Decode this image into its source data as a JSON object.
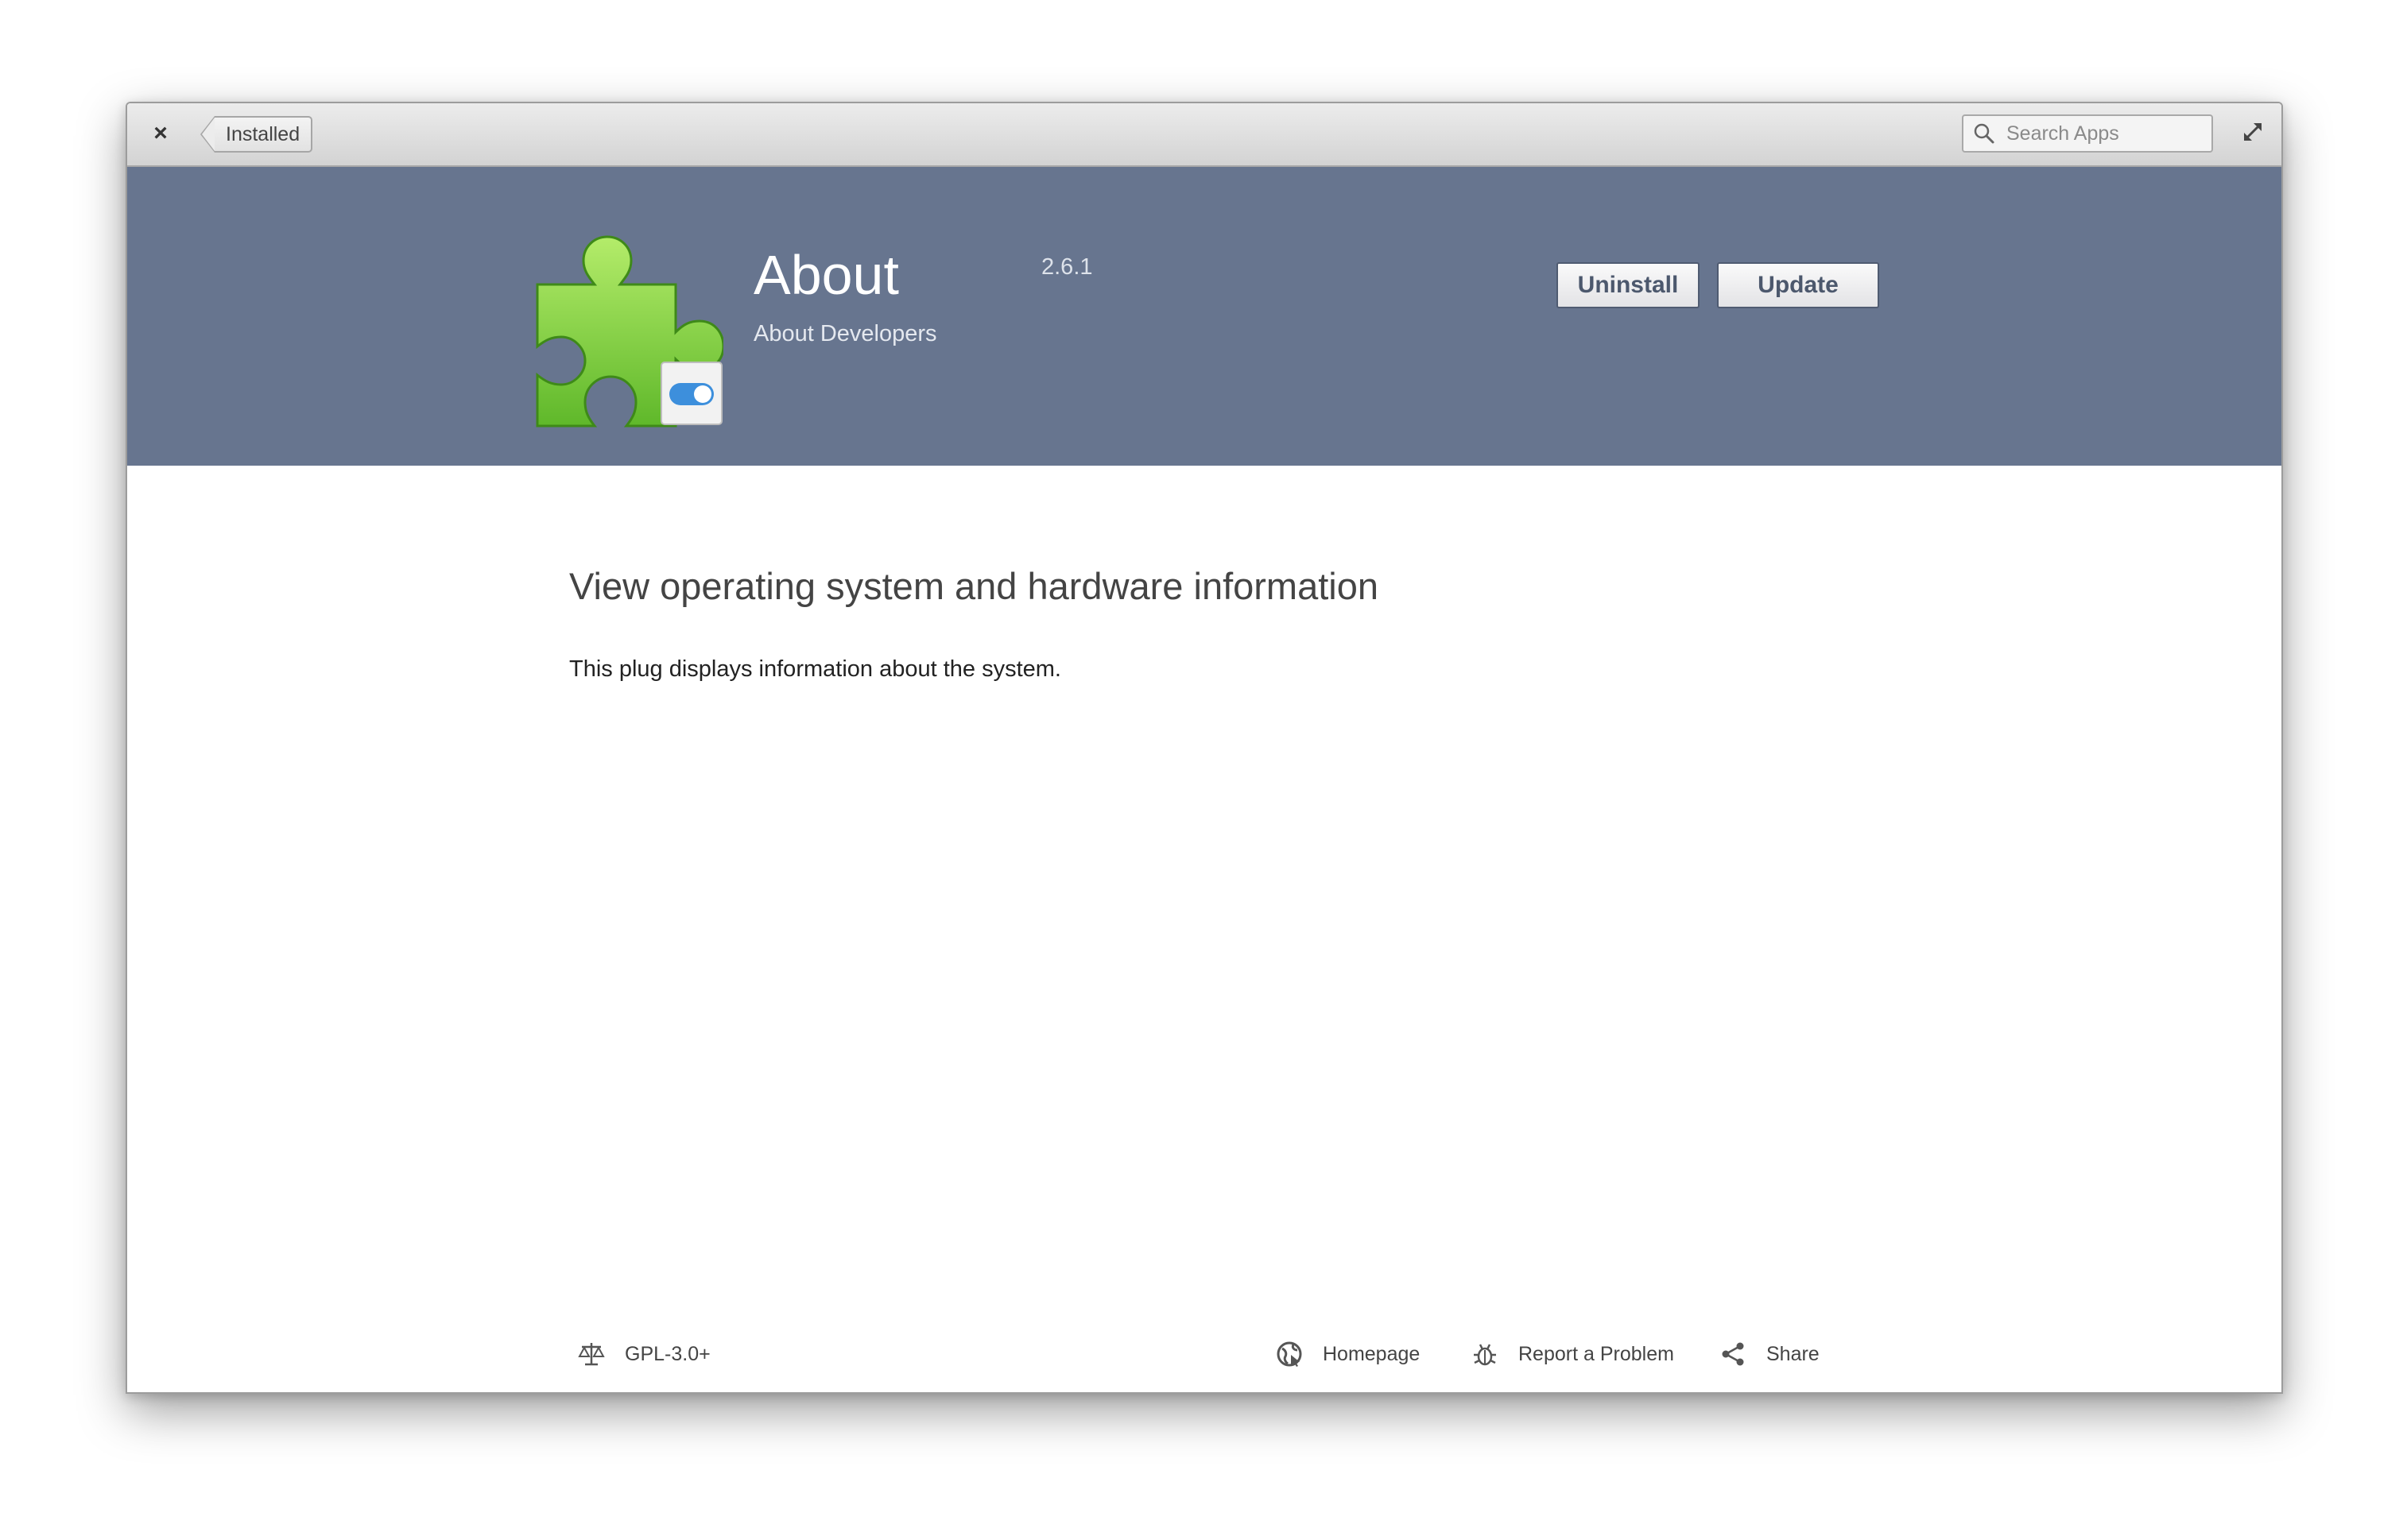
{
  "titlebar": {
    "close_symbol": "×",
    "back_label": "Installed",
    "search_placeholder": "Search Apps"
  },
  "app": {
    "name": "About",
    "version": "2.6.1",
    "developer": "About Developers",
    "icon": "puzzle-piece-with-toggle-icon"
  },
  "actions": {
    "uninstall_label": "Uninstall",
    "update_label": "Update"
  },
  "content": {
    "summary": "View operating system and hardware information",
    "description": "This plug displays information about the system."
  },
  "footer": {
    "license": "GPL-3.0+",
    "homepage": "Homepage",
    "report": "Report a Problem",
    "share": "Share"
  },
  "colors": {
    "banner": "#67758f",
    "button_text": "#4c586d",
    "toggle_accent": "#3d8fdc",
    "puzzle_green": "#7fd13b"
  }
}
